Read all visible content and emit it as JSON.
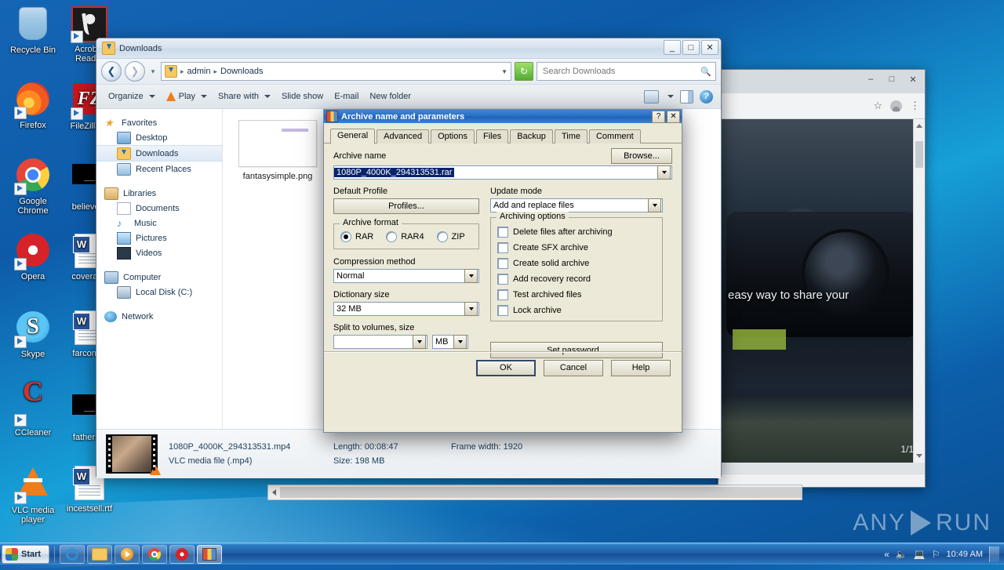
{
  "desktop": {
    "icons": [
      {
        "label": "Recycle Bin",
        "icon": "recycle-bin-icon",
        "shortcut": false
      },
      {
        "label": "Acrobat Reader",
        "icon": "acrobat-reader-icon",
        "shortcut": true
      },
      {
        "label": "Firefox",
        "icon": "firefox-icon",
        "shortcut": true
      },
      {
        "label": "FileZilla C",
        "icon": "filezilla-icon",
        "shortcut": true
      },
      {
        "label": "Google Chrome",
        "icon": "google-chrome-icon",
        "shortcut": true
      },
      {
        "label": "believere",
        "icon": "black-file-icon",
        "shortcut": false
      },
      {
        "label": "Opera",
        "icon": "opera-icon",
        "shortcut": true
      },
      {
        "label": "coverage",
        "icon": "word-document-icon",
        "shortcut": false
      },
      {
        "label": "Skype",
        "icon": "skype-icon",
        "shortcut": true
      },
      {
        "label": "farcontro",
        "icon": "word-document-icon",
        "shortcut": false
      },
      {
        "label": "CCleaner",
        "icon": "ccleaner-icon",
        "shortcut": true
      },
      {
        "label": "fathersel",
        "icon": "black-file-icon",
        "shortcut": false
      },
      {
        "label": "VLC media player",
        "icon": "vlc-media-player-icon",
        "shortcut": true
      },
      {
        "label": "incestsell.rtf",
        "icon": "word-document-icon",
        "shortcut": false
      }
    ]
  },
  "explorer": {
    "title": "Downloads",
    "window_buttons": {
      "minimize": "_",
      "maximize": "□",
      "close": "✕"
    },
    "address": {
      "crumbs": [
        "admin",
        "Downloads"
      ],
      "separator": "▸",
      "dropdown": "▼",
      "refresh": "↻"
    },
    "search": {
      "placeholder": "Search Downloads",
      "value": ""
    },
    "toolbar": {
      "items": [
        {
          "label": "Organize",
          "has_caret": true,
          "icon": ""
        },
        {
          "label": "Play",
          "has_caret": true,
          "icon": "vlc-icon"
        },
        {
          "label": "Share with",
          "has_caret": true,
          "icon": ""
        },
        {
          "label": "Slide show",
          "has_caret": false,
          "icon": ""
        },
        {
          "label": "E-mail",
          "has_caret": false,
          "icon": ""
        },
        {
          "label": "New folder",
          "has_caret": false,
          "icon": ""
        }
      ]
    },
    "navigation": [
      {
        "label": "Favorites",
        "icon": "favorites-star-icon",
        "level": 0,
        "selected": false
      },
      {
        "label": "Desktop",
        "icon": "desktop-icon",
        "level": 1,
        "selected": false
      },
      {
        "label": "Downloads",
        "icon": "downloads-folder-icon",
        "level": 1,
        "selected": true
      },
      {
        "label": "Recent Places",
        "icon": "recent-places-icon",
        "level": 1,
        "selected": false
      },
      {
        "label": "Libraries",
        "icon": "libraries-icon",
        "level": 0,
        "selected": false
      },
      {
        "label": "Documents",
        "icon": "documents-icon",
        "level": 1,
        "selected": false
      },
      {
        "label": "Music",
        "icon": "music-icon",
        "level": 1,
        "selected": false
      },
      {
        "label": "Pictures",
        "icon": "pictures-icon",
        "level": 1,
        "selected": false
      },
      {
        "label": "Videos",
        "icon": "videos-icon",
        "level": 1,
        "selected": false
      },
      {
        "label": "Computer",
        "icon": "computer-icon",
        "level": 0,
        "selected": false
      },
      {
        "label": "Local Disk (C:)",
        "icon": "local-disk-icon",
        "level": 1,
        "selected": false
      },
      {
        "label": "Network",
        "icon": "network-icon",
        "level": 0,
        "selected": false
      }
    ],
    "files": [
      {
        "name": "fantasysimple.png",
        "type": "png-image"
      }
    ],
    "status": {
      "file_name": "1080P_4000K_294313531.mp4",
      "file_type": "VLC media file (.mp4)",
      "length_label": "Length: 00:08:47",
      "size_label": "Size: 198 MB",
      "frame_width_label": "Frame width: 1920"
    }
  },
  "winrar": {
    "title": "Archive name and parameters",
    "title_buttons": {
      "help": "?",
      "close": "✕"
    },
    "tabs": [
      {
        "label": "General",
        "active": true
      },
      {
        "label": "Advanced",
        "active": false
      },
      {
        "label": "Options",
        "active": false
      },
      {
        "label": "Files",
        "active": false
      },
      {
        "label": "Backup",
        "active": false
      },
      {
        "label": "Time",
        "active": false
      },
      {
        "label": "Comment",
        "active": false
      }
    ],
    "archive_name": {
      "label": "Archive name",
      "value": "1080P_4000K_294313531.rar",
      "selected": true
    },
    "browse_button": "Browse...",
    "default_profile": {
      "label": "Default Profile",
      "button": "Profiles..."
    },
    "update_mode": {
      "label": "Update mode",
      "value": "Add and replace files"
    },
    "archive_format": {
      "label": "Archive format",
      "options": [
        {
          "label": "RAR",
          "checked": true
        },
        {
          "label": "RAR4",
          "checked": false
        },
        {
          "label": "ZIP",
          "checked": false
        }
      ]
    },
    "compression_method": {
      "label": "Compression method",
      "value": "Normal"
    },
    "dictionary_size": {
      "label": "Dictionary size",
      "value": "32 MB"
    },
    "split_to_volumes": {
      "label": "Split to volumes, size",
      "value": "",
      "unit": "MB"
    },
    "archiving_options": {
      "label": "Archiving options",
      "items": [
        {
          "label": "Delete files after archiving",
          "checked": false
        },
        {
          "label": "Create SFX archive",
          "checked": false
        },
        {
          "label": "Create solid archive",
          "checked": false
        },
        {
          "label": "Add recovery record",
          "checked": false
        },
        {
          "label": "Test archived files",
          "checked": false
        },
        {
          "label": "Lock archive",
          "checked": false
        }
      ]
    },
    "set_password_button": "Set password...",
    "footer": {
      "ok": "OK",
      "cancel": "Cancel",
      "help": "Help"
    }
  },
  "browser": {
    "window_buttons": {
      "minimize": "–",
      "maximize": "□",
      "close": "✕"
    },
    "toolbar_icons": [
      "bookmark-star-icon",
      "profile-avatar-icon",
      "chrome-menu-icon"
    ],
    "page": {
      "caption": "easy way to share your",
      "page_indicator": "1/1"
    }
  },
  "taskbar": {
    "start_label": "Start",
    "buttons": [
      {
        "name": "internet-explorer",
        "icon": "internet-explorer-icon",
        "active": false
      },
      {
        "name": "windows-explorer",
        "icon": "windows-explorer-icon",
        "active": false
      },
      {
        "name": "windows-media-player",
        "icon": "windows-media-player-icon",
        "active": false
      },
      {
        "name": "google-chrome",
        "icon": "google-chrome-icon",
        "active": false
      },
      {
        "name": "opera",
        "icon": "opera-icon",
        "active": false
      },
      {
        "name": "winrar",
        "icon": "winrar-icon",
        "active": true
      }
    ],
    "tray": {
      "show_hidden": "«",
      "volume": "volume-icon",
      "network": "network-icon",
      "action_center": "flag-icon",
      "clock": "10:49 AM"
    }
  },
  "watermark": {
    "left": "ANY",
    "right": "RUN"
  }
}
